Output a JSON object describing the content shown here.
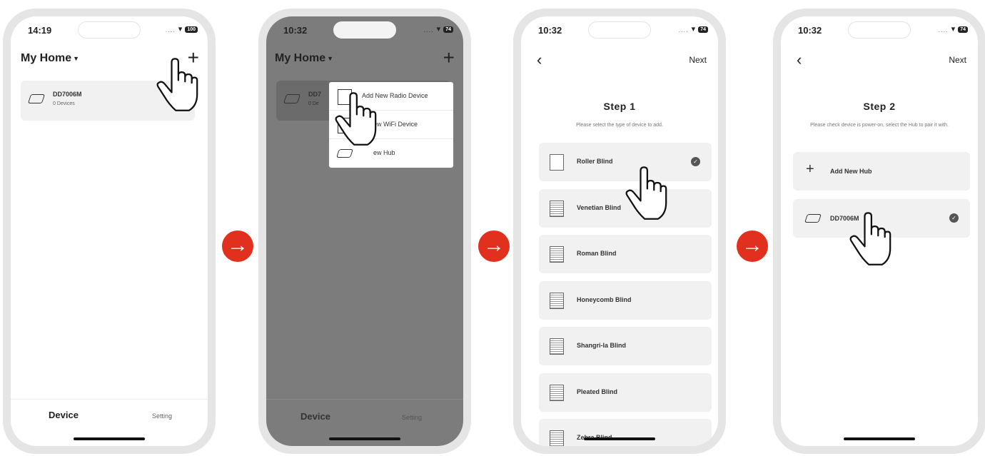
{
  "phone1": {
    "time": "14:19",
    "battery": "100",
    "home_title": "My Home",
    "hub": {
      "name": "DD7006M",
      "sub": "0 Devices"
    },
    "tabs": {
      "device": "Device",
      "setting": "Setting"
    }
  },
  "phone2": {
    "time": "10:32",
    "battery": "74",
    "home_title": "My Home",
    "hub": {
      "name": "DD7",
      "sub": "0 De"
    },
    "menu": [
      {
        "label": "Add New Radio Device"
      },
      {
        "label": "ew WiFi Device"
      },
      {
        "label": "ew Hub"
      }
    ],
    "tabs": {
      "device": "Device",
      "setting": "Setting"
    }
  },
  "phone3": {
    "time": "10:32",
    "battery": "74",
    "next": "Next",
    "step_title": "Step 1",
    "step_desc": "Please select the type of device to add.",
    "types": [
      {
        "label": "Roller Blind",
        "selected": true
      },
      {
        "label": "Venetian Blind"
      },
      {
        "label": "Roman Blind"
      },
      {
        "label": "Honeycomb Blind"
      },
      {
        "label": "Shangri-la Blind"
      },
      {
        "label": "Pleated Blind"
      },
      {
        "label": "Zebra Blind"
      }
    ]
  },
  "phone4": {
    "time": "10:32",
    "battery": "74",
    "next": "Next",
    "step_title": "Step 2",
    "step_desc": "Please check device is power-on, select the Hub to pair it with.",
    "options": [
      {
        "label": "Add New Hub"
      },
      {
        "label": "DD7006M",
        "selected": true
      }
    ]
  },
  "icons": {
    "wifi": "wifi-icon",
    "back": "chevron-left-icon",
    "add": "plus-icon",
    "check": "check-circle-icon",
    "pointer": "hand-pointer-icon",
    "arrow": "arrow-right-circle-icon"
  },
  "colors": {
    "arrow": "#e2301e",
    "dim_overlay": "#7c7c7c",
    "card": "#f1f1f1"
  }
}
